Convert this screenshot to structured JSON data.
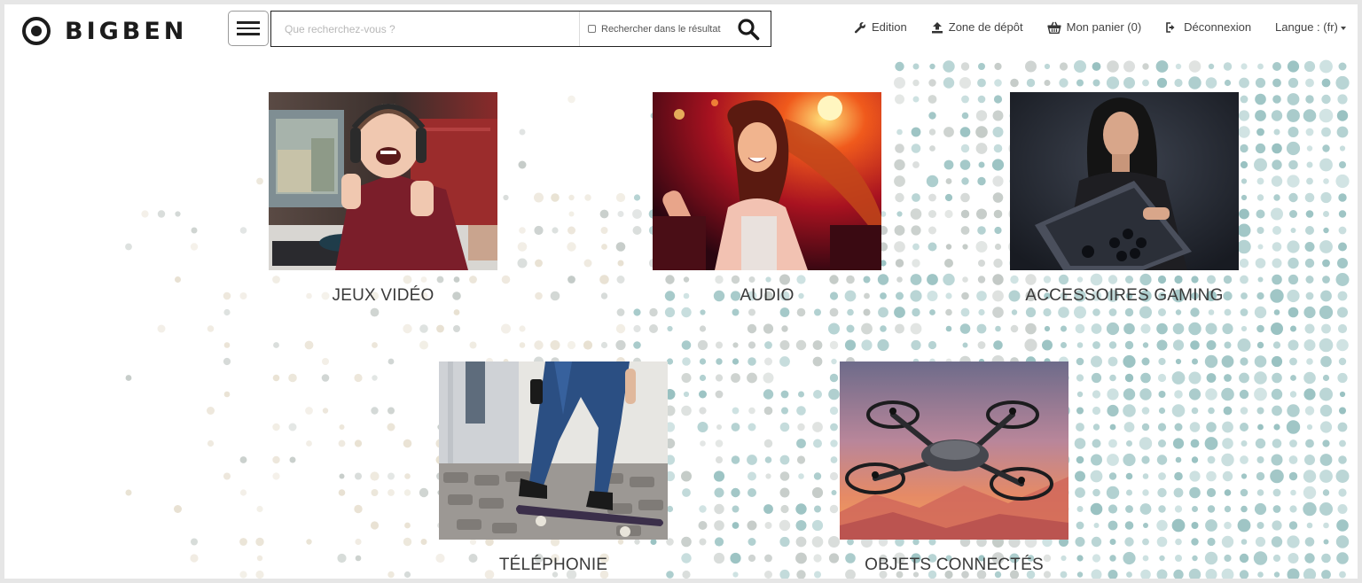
{
  "brand": {
    "name": "BIGBEN"
  },
  "search": {
    "placeholder": "Que recherchez-vous ?",
    "value": "",
    "option_label": "Rechercher dans le résultat"
  },
  "nav": {
    "edition": "Edition",
    "upload": "Zone de dépôt",
    "cart": "Mon panier (0)",
    "logout": "Déconnexion",
    "language": "Langue : (fr)"
  },
  "categories": [
    {
      "label": "JEUX VIDÉO"
    },
    {
      "label": "AUDIO"
    },
    {
      "label": "ACCESSOIRES GAMING"
    },
    {
      "label": "TÉLÉPHONIE"
    },
    {
      "label": "OBJETS CONNECTÉS"
    }
  ],
  "colors": {
    "dots_teal": "#7fb2b2",
    "dots_grey": "#b4bcb8",
    "dots_beige": "#e2d9c6",
    "text": "#3a3a3a"
  },
  "icons": [
    "menu-icon",
    "search-icon",
    "wrench-icon",
    "upload-icon",
    "basket-icon",
    "logout-icon",
    "caret-down-icon"
  ]
}
